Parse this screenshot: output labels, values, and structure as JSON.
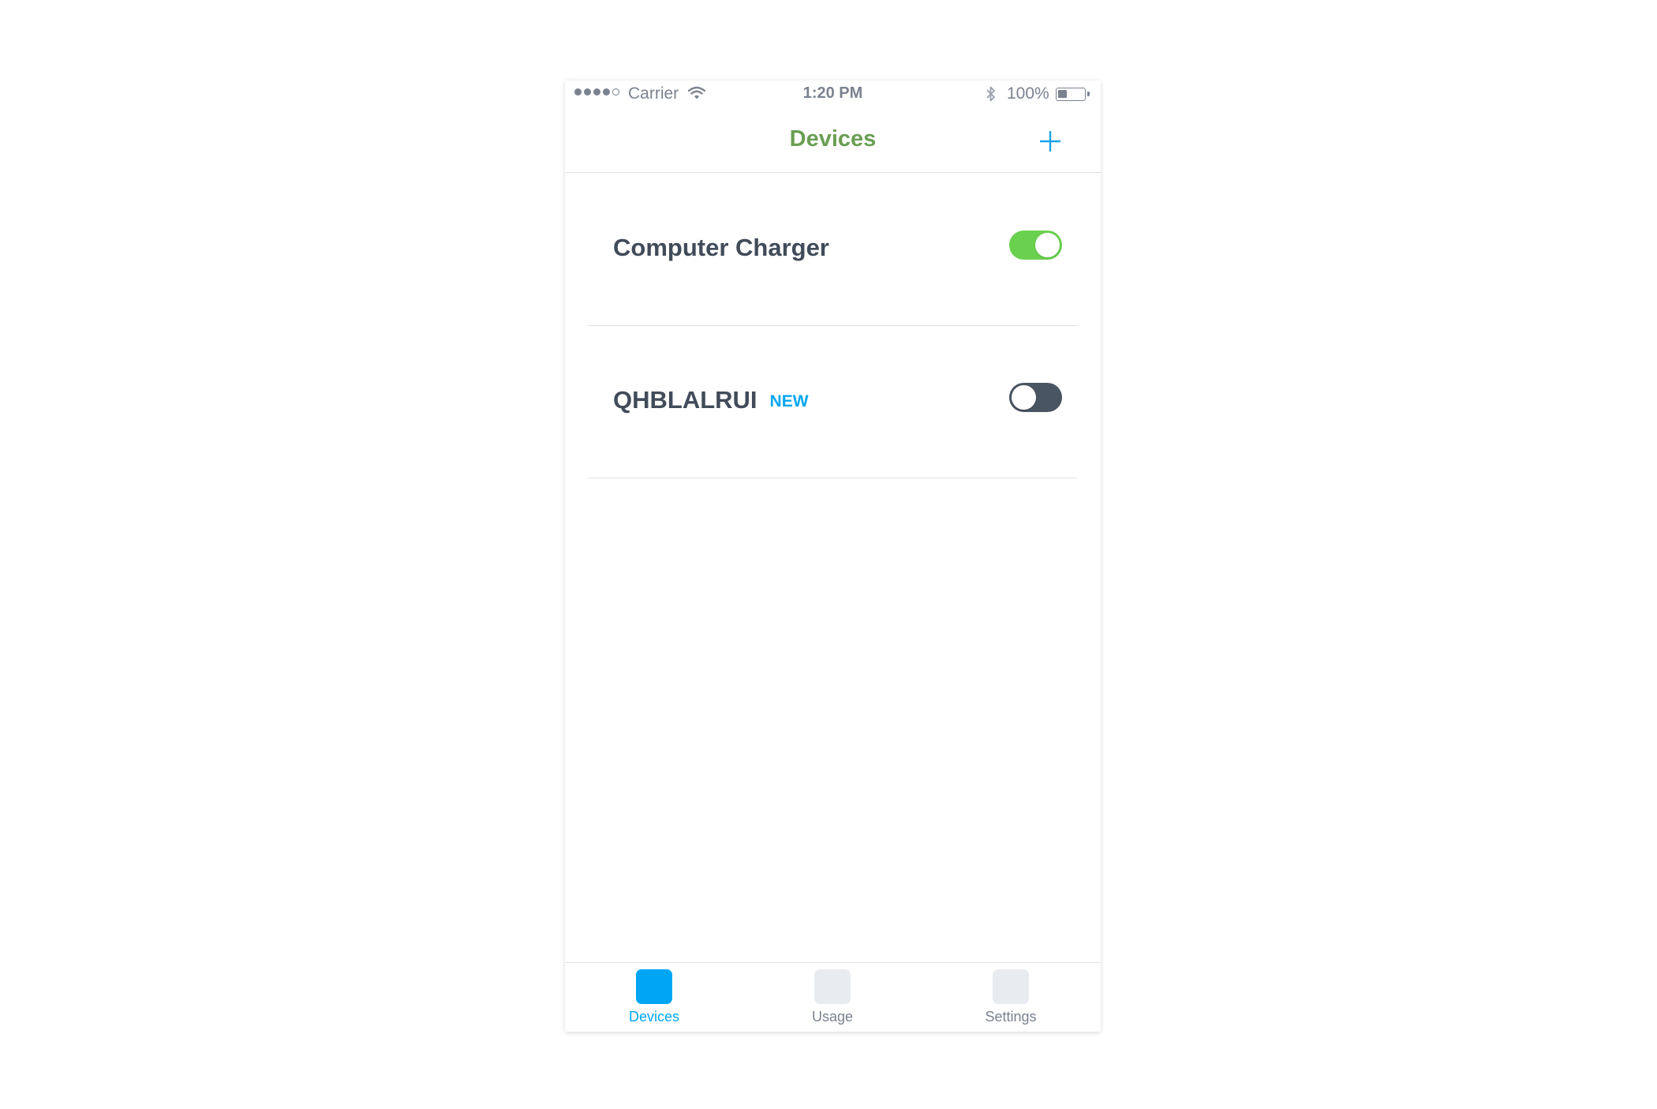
{
  "status_bar": {
    "signal_bars_filled": 4,
    "signal_bars_total": 5,
    "carrier": "Carrier",
    "time": "1:20 PM",
    "battery_percent": "100%",
    "battery_level": 0.35,
    "icons": [
      "signal-icon",
      "wifi-icon",
      "bluetooth-icon",
      "battery-icon"
    ]
  },
  "nav": {
    "title": "Devices",
    "add_icon": "plus-icon"
  },
  "devices": [
    {
      "name": "Computer Charger",
      "badge": "",
      "on": true
    },
    {
      "name": "QHBLALRUI",
      "badge": "NEW",
      "on": false
    }
  ],
  "tabs": [
    {
      "label": "Devices",
      "active": true
    },
    {
      "label": "Usage",
      "active": false
    },
    {
      "label": "Settings",
      "active": false
    }
  ],
  "colors": {
    "title_green": "#6a9e52",
    "accent_blue": "#00a6f4",
    "toggle_on": "#6ad14f",
    "toggle_off": "#4a5563",
    "text_dark": "#414b59",
    "text_gray": "#7a8290"
  }
}
